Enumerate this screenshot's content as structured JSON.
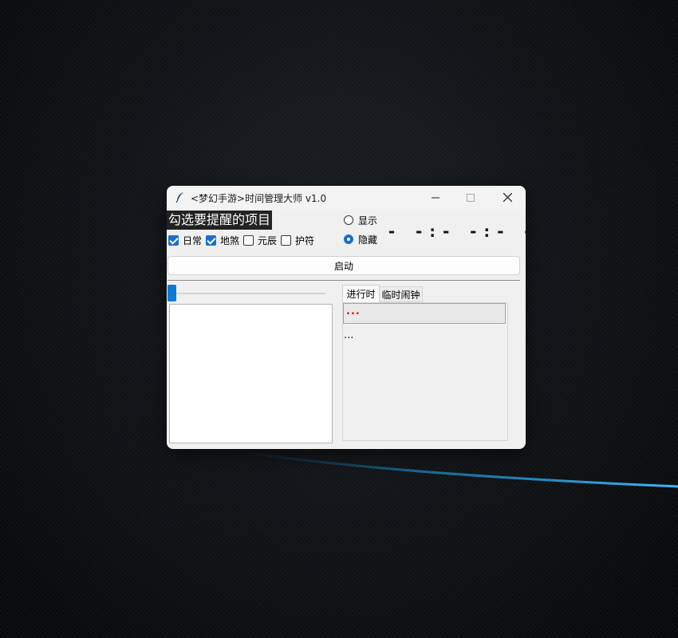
{
  "window": {
    "title": "<梦幻手游>时间管理大师 v1.0",
    "icon": "feather-icon",
    "controls": {
      "minimize": "minimize-icon",
      "maximize": "maximize-icon",
      "close": "close-icon"
    }
  },
  "heading": "勾选要提醒的项目",
  "checkboxes": [
    {
      "label": "日常",
      "checked": true
    },
    {
      "label": "地煞",
      "checked": true
    },
    {
      "label": "元辰",
      "checked": false
    },
    {
      "label": "护符",
      "checked": false
    }
  ],
  "radios": [
    {
      "label": "显示",
      "selected": false
    },
    {
      "label": "隐藏",
      "selected": true
    }
  ],
  "clock_display": "- -:- -:- -",
  "start_button": "启动",
  "slider_value": 0,
  "tabs": [
    {
      "label": "进行时",
      "active": true
    },
    {
      "label": "临时闹钟",
      "active": false
    }
  ],
  "entry_value": "...",
  "panel_text": "...",
  "colors": {
    "accent": "#1a6fd0",
    "entry_text": "#e00000",
    "heading_bg": "#222222"
  }
}
